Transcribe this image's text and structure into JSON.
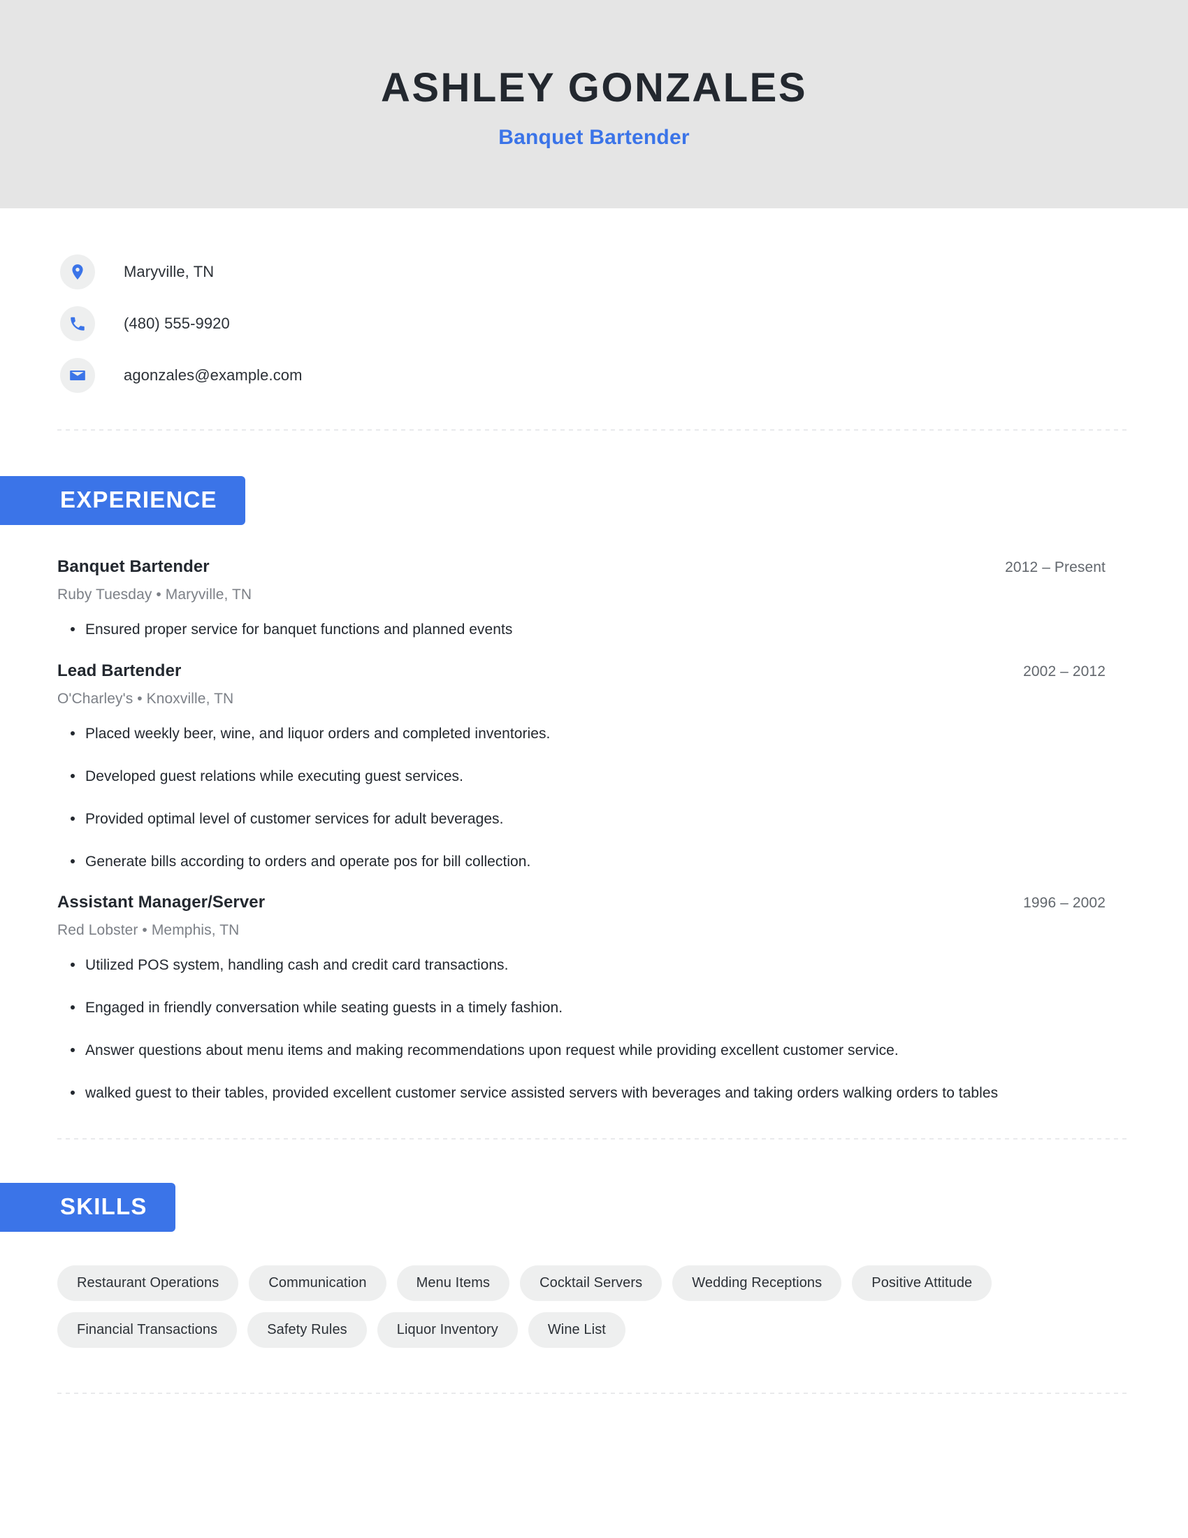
{
  "header": {
    "full_name": "ASHLEY GONZALES",
    "job_title": "Banquet Bartender"
  },
  "contact": {
    "items": [
      {
        "icon": "location-pin-icon",
        "text": "Maryville, TN"
      },
      {
        "icon": "phone-icon",
        "text": "(480) 555-9920"
      },
      {
        "icon": "envelope-icon",
        "text": "agonzales@example.com"
      }
    ]
  },
  "sections": {
    "experience_label": "EXPERIENCE",
    "skills_label": "SKILLS"
  },
  "experience": {
    "jobs": [
      {
        "position": "Banquet Bartender",
        "dates": "2012 – Present",
        "company": "Ruby Tuesday",
        "location": "Maryville, TN",
        "meta": "Ruby Tuesday  •  Maryville, TN",
        "bullets": [
          "Ensured proper service for banquet functions and planned events"
        ]
      },
      {
        "position": "Lead Bartender",
        "dates": "2002 – 2012",
        "company": "O'Charley's",
        "location": "Knoxville, TN",
        "meta": "O'Charley's  •  Knoxville, TN",
        "bullets": [
          "Placed weekly beer, wine, and liquor orders and completed inventories.",
          "Developed guest relations while executing guest services.",
          "Provided optimal level of customer services for adult beverages.",
          "Generate bills according to orders and operate pos for bill collection."
        ]
      },
      {
        "position": "Assistant Manager/Server",
        "dates": "1996 – 2002",
        "company": "Red Lobster",
        "location": "Memphis, TN",
        "meta": "Red Lobster  •  Memphis, TN",
        "bullets": [
          "Utilized POS system, handling cash and credit card transactions.",
          "Engaged in friendly conversation while seating guests in a timely fashion.",
          "Answer questions about menu items and making recommendations upon request while providing excellent customer service.",
          "walked guest to their tables, provided excellent customer service assisted servers with beverages and taking orders walking orders to tables"
        ]
      }
    ]
  },
  "skills": {
    "items": [
      "Restaurant Operations",
      "Communication",
      "Menu Items",
      "Cocktail Servers",
      "Wedding Receptions",
      "Positive Attitude",
      "Financial Transactions",
      "Safety Rules",
      "Liquor Inventory",
      "Wine List"
    ]
  },
  "colors": {
    "accent_blue": "#3b74e8",
    "header_band_gray": "#e5e5e5",
    "pill_gray": "#eeefef",
    "text_dark": "#23282f",
    "text_muted": "#7c8087"
  }
}
